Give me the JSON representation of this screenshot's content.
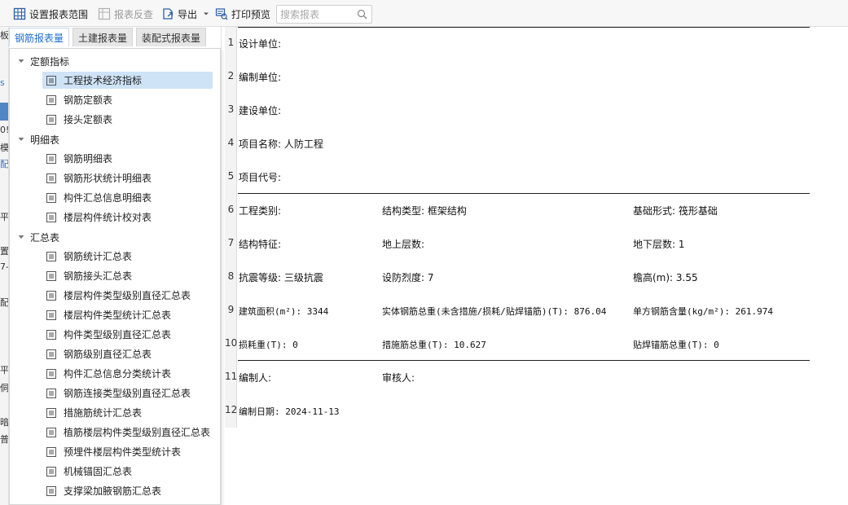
{
  "toolbar": {
    "set_range": "设置报表范围",
    "reverse_check": "报表反查",
    "export": "导出",
    "print_preview": "打印预览",
    "search_placeholder": "搜索报表"
  },
  "left_strip": {
    "fragments": [
      "板",
      "s",
      "0!",
      "模",
      "配",
      "平",
      "置",
      "7-",
      "配",
      "平",
      "侗",
      "暗",
      "普"
    ]
  },
  "tabs": [
    {
      "label": "钢筋报表量",
      "active": true
    },
    {
      "label": "土建报表量",
      "active": false
    },
    {
      "label": "装配式报表量",
      "active": false
    }
  ],
  "tree": {
    "groups": [
      {
        "label": "定额指标",
        "items": [
          "工程技术经济指标",
          "钢筋定额表",
          "接头定额表"
        ]
      },
      {
        "label": "明细表",
        "items": [
          "钢筋明细表",
          "钢筋形状统计明细表",
          "构件汇总信息明细表",
          "楼层构件统计校对表"
        ]
      },
      {
        "label": "汇总表",
        "items": [
          "钢筋统计汇总表",
          "钢筋接头汇总表",
          "楼层构件类型级别直径汇总表",
          "楼层构件类型统计汇总表",
          "构件类型级别直径汇总表",
          "钢筋级别直径汇总表",
          "构件汇总信息分类统计表",
          "钢筋连接类型级别直径汇总表",
          "措施筋统计汇总表",
          "植筋楼层构件类型级别直径汇总表",
          "预埋件楼层构件类型统计表",
          "机械锚固汇总表",
          "支撑梁加腋钢筋汇总表"
        ]
      }
    ],
    "selected": "工程技术经济指标"
  },
  "report": {
    "row_numbers": [
      "1",
      "2",
      "3",
      "4",
      "5",
      "6",
      "7",
      "8",
      "9",
      "10",
      "11",
      "12"
    ],
    "design_unit": "设计单位:",
    "compile_unit": "编制单位:",
    "build_unit": "建设单位:",
    "project_name": "项目名称: 人防工程",
    "project_code": "项目代号:",
    "project_type": "工程类别:",
    "structure_type": "结构类型: 框架结构",
    "foundation_type": "基础形式: 筏形基础",
    "structure_feature": "结构特征:",
    "floors_above": "地上层数:",
    "floors_below": "地下层数: 1",
    "seismic_grade": "抗震等级: 三级抗震",
    "seismic_intensity": "设防烈度: 7",
    "eave_height": "檐高(m): 3.55",
    "building_area": "建筑面积(m²): 3344",
    "rebar_total": "实体钢筋总重(未含措施/损耗/贴焊锚筋)(T): 876.04",
    "rebar_per_m2": "单方钢筋含量(kg/m²): 261.974",
    "loss_weight": "损耗重(T): 0",
    "measure_rebar": "措施筋总重(T): 10.627",
    "weld_anchor": "贴焊锚筋总重(T): 0",
    "compiler": "编制人:",
    "reviewer": "审核人:",
    "compile_date": "编制日期: 2024-11-13"
  }
}
